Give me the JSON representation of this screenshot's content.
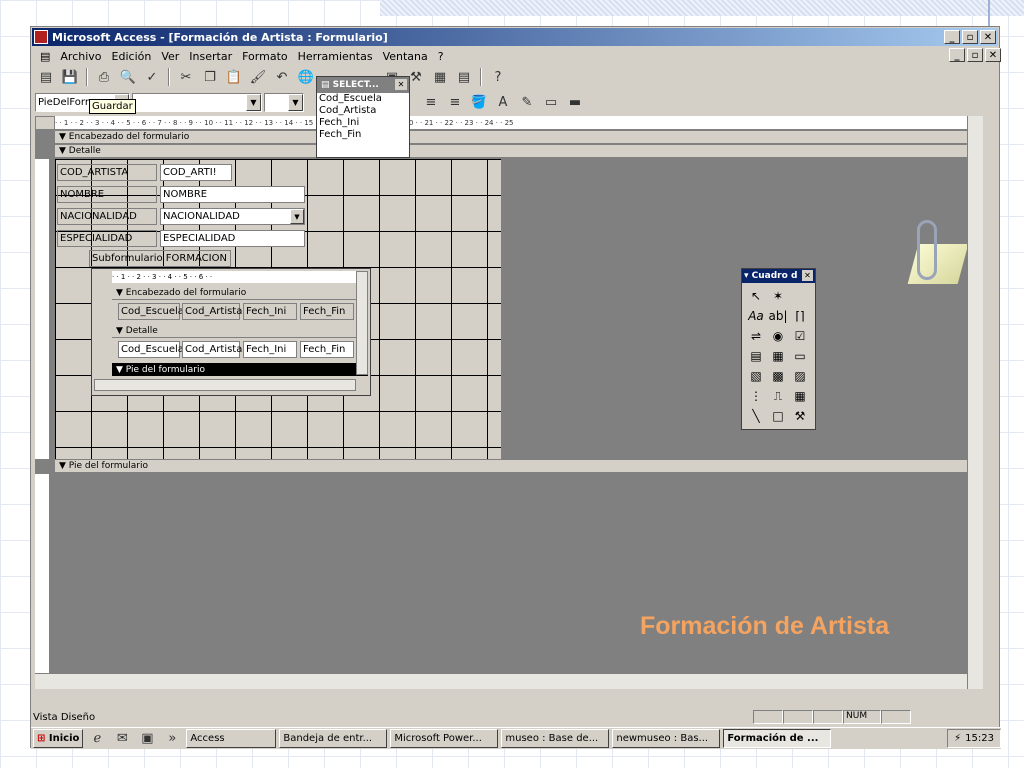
{
  "window": {
    "title": "Microsoft Access - [Formación de Artista : Formulario]"
  },
  "menu": [
    "Archivo",
    "Edición",
    "Ver",
    "Insertar",
    "Formato",
    "Herramientas",
    "Ventana",
    "?"
  ],
  "toolbar": {
    "object_combo": "PieDelForr",
    "tooltip": "Guardar"
  },
  "select_window": {
    "title": "SELECT...",
    "fields": [
      "Cod_Escuela",
      "Cod_Artista",
      "Fech_Ini",
      "Fech_Fin"
    ]
  },
  "sections": {
    "header": "Encabezado del formulario",
    "detail": "Detalle",
    "footer": "Pie del formulario"
  },
  "form_fields": [
    {
      "label": "COD_ARTISTA",
      "value": "COD_ARTI!"
    },
    {
      "label": "NOMBRE",
      "value": "NOMBRE"
    },
    {
      "label": "NACIONALIDAD",
      "value": "NACIONALIDAD"
    },
    {
      "label": "ESPECIALIDAD",
      "value": "ESPECIALIDAD"
    }
  ],
  "subform": {
    "label": "Subformulario FORMACION",
    "header": "Encabezado del formulario",
    "detail": "Detalle",
    "footer": "Pie del formulario",
    "header_labels": [
      "Cod_Escuela",
      "Cod_Artista",
      "Fech_Ini",
      "Fech_Fin"
    ],
    "detail_fields": [
      "Cod_Escuela",
      "Cod_Artista",
      "Fech_Ini",
      "Fech_Fin"
    ]
  },
  "palette": {
    "title": "Cuadro d",
    "tools": [
      "arrow",
      "wizard",
      "Aa",
      "ab|",
      "frame",
      "toggle",
      "radio",
      "check",
      "combo",
      "list",
      "button",
      "image",
      "unbound",
      "bound",
      "page-break",
      "tab",
      "subform",
      "line",
      "rect",
      "more"
    ]
  },
  "status": {
    "left": "Vista Diseño",
    "num": "NUM"
  },
  "taskbar": {
    "start": "Inicio",
    "items": [
      "Access",
      "Bandeja de entr...",
      "Microsoft Power...",
      "museo : Base de...",
      "newmuseo : Bas...",
      "Formación de ..."
    ],
    "clock": "15:23"
  },
  "overlay_title": "Formación de Artista",
  "colors": {
    "title_bar": "#0a246a",
    "overlay_title": "#f4a460"
  }
}
